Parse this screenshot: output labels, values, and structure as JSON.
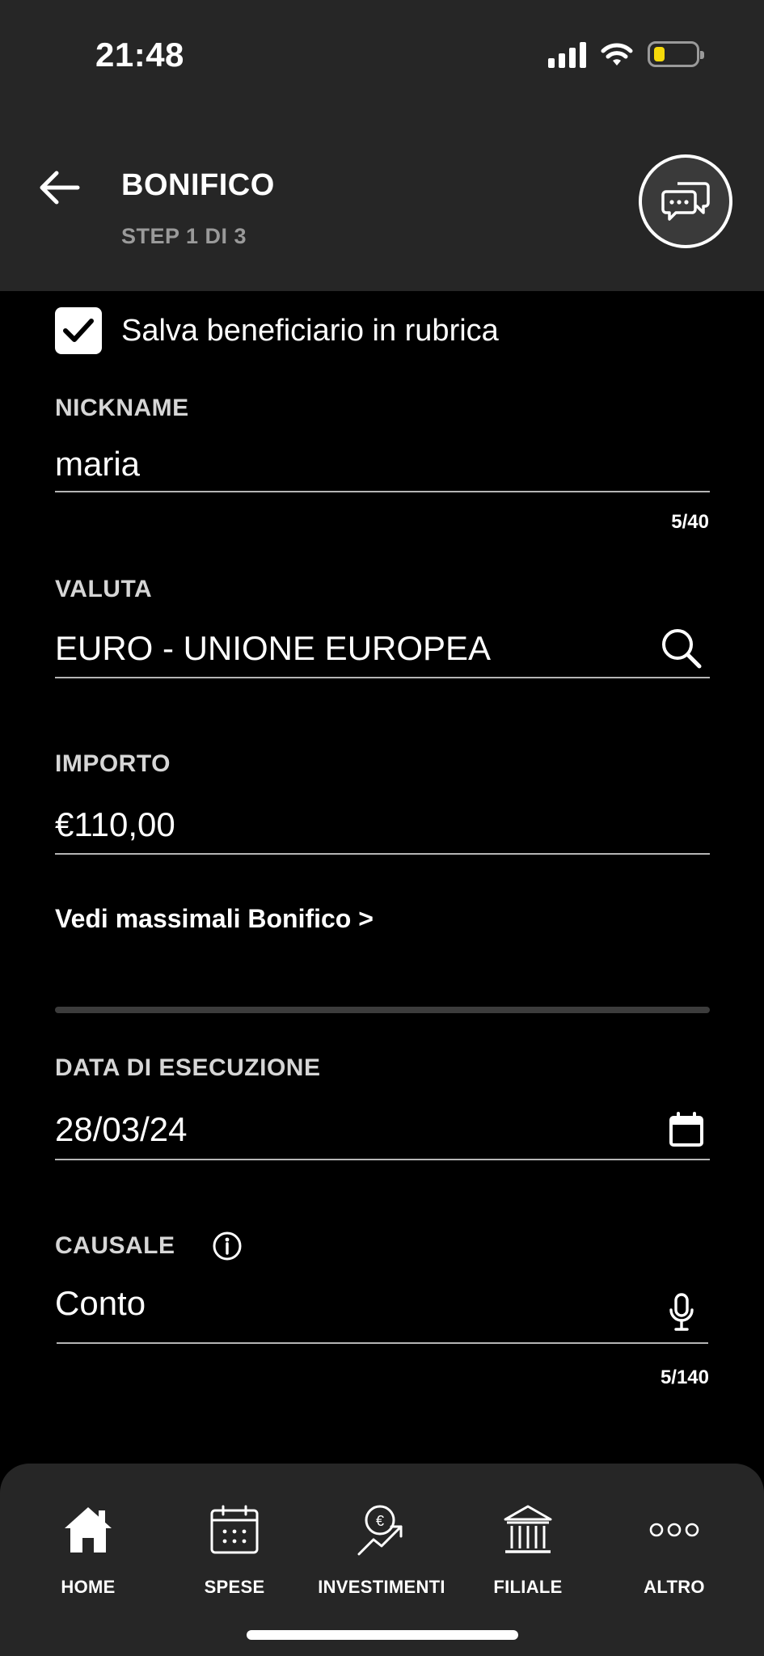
{
  "status_bar": {
    "time": "21:48"
  },
  "header": {
    "title": "BONIFICO",
    "step": "STEP 1 DI 3"
  },
  "form": {
    "save_beneficiary": {
      "label": "Salva beneficiario in rubrica",
      "checked": true
    },
    "nickname": {
      "label": "NICKNAME",
      "value": "maria",
      "counter": "5/40"
    },
    "valuta": {
      "label": "VALUTA",
      "value": "EURO - UNIONE EUROPEA"
    },
    "importo": {
      "label": "IMPORTO",
      "value": "€110,00"
    },
    "massimali_link": "Vedi massimali Bonifico >",
    "data_esecuzione": {
      "label": "DATA DI ESECUZIONE",
      "value": "28/03/24"
    },
    "causale": {
      "label": "CAUSALE",
      "value": "Conto",
      "counter": "5/140"
    }
  },
  "tabbar": {
    "items": [
      {
        "label": "HOME",
        "icon": "home-icon"
      },
      {
        "label": "SPESE",
        "icon": "calendar-icon"
      },
      {
        "label": "INVESTIMENTI",
        "icon": "investments-icon"
      },
      {
        "label": "FILIALE",
        "icon": "bank-icon"
      },
      {
        "label": "ALTRO",
        "icon": "more-icon"
      }
    ]
  },
  "colors": {
    "header_bg": "#262626",
    "page_bg": "#000000",
    "battery": "#f5d90a"
  }
}
